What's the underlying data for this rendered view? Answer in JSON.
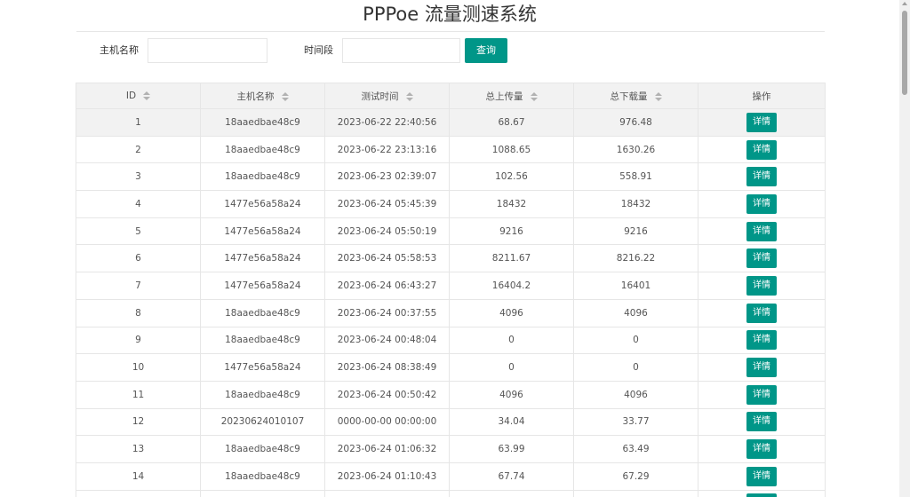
{
  "page": {
    "title": "PPPoe 流量测速系统"
  },
  "search": {
    "host_label": "主机名称",
    "host_value": "",
    "period_label": "时间段",
    "period_value": "",
    "query_button": "查询"
  },
  "table": {
    "headers": {
      "id": "ID",
      "host": "主机名称",
      "time": "测试时间",
      "upload": "总上传量",
      "download": "总下载量",
      "action": "操作"
    },
    "detail_label": "详情",
    "rows": [
      {
        "id": "1",
        "host": "18aaedbae48c9",
        "time": "2023-06-22 22:40:56",
        "upload": "68.67",
        "download": "976.48"
      },
      {
        "id": "2",
        "host": "18aaedbae48c9",
        "time": "2023-06-22 23:13:16",
        "upload": "1088.65",
        "download": "1630.26"
      },
      {
        "id": "3",
        "host": "18aaedbae48c9",
        "time": "2023-06-23 02:39:07",
        "upload": "102.56",
        "download": "558.91"
      },
      {
        "id": "4",
        "host": "1477e56a58a24",
        "time": "2023-06-24 05:45:39",
        "upload": "18432",
        "download": "18432"
      },
      {
        "id": "5",
        "host": "1477e56a58a24",
        "time": "2023-06-24 05:50:19",
        "upload": "9216",
        "download": "9216"
      },
      {
        "id": "6",
        "host": "1477e56a58a24",
        "time": "2023-06-24 05:58:53",
        "upload": "8211.67",
        "download": "8216.22"
      },
      {
        "id": "7",
        "host": "1477e56a58a24",
        "time": "2023-06-24 06:43:27",
        "upload": "16404.2",
        "download": "16401"
      },
      {
        "id": "8",
        "host": "18aaedbae48c9",
        "time": "2023-06-24 00:37:55",
        "upload": "4096",
        "download": "4096"
      },
      {
        "id": "9",
        "host": "18aaedbae48c9",
        "time": "2023-06-24 00:48:04",
        "upload": "0",
        "download": "0"
      },
      {
        "id": "10",
        "host": "1477e56a58a24",
        "time": "2023-06-24 08:38:49",
        "upload": "0",
        "download": "0"
      },
      {
        "id": "11",
        "host": "18aaedbae48c9",
        "time": "2023-06-24 00:50:42",
        "upload": "4096",
        "download": "4096"
      },
      {
        "id": "12",
        "host": "20230624010107",
        "time": "0000-00-00 00:00:00",
        "upload": "34.04",
        "download": "33.77"
      },
      {
        "id": "13",
        "host": "18aaedbae48c9",
        "time": "2023-06-24 01:06:32",
        "upload": "63.99",
        "download": "63.49"
      },
      {
        "id": "14",
        "host": "18aaedbae48c9",
        "time": "2023-06-24 01:10:43",
        "upload": "67.74",
        "download": "67.29"
      },
      {
        "id": "",
        "host": "",
        "time": "",
        "upload": "",
        "download": ""
      }
    ]
  },
  "colors": {
    "accent": "#009688",
    "header_bg": "#f2f2f2",
    "border": "#e6e6e6"
  }
}
